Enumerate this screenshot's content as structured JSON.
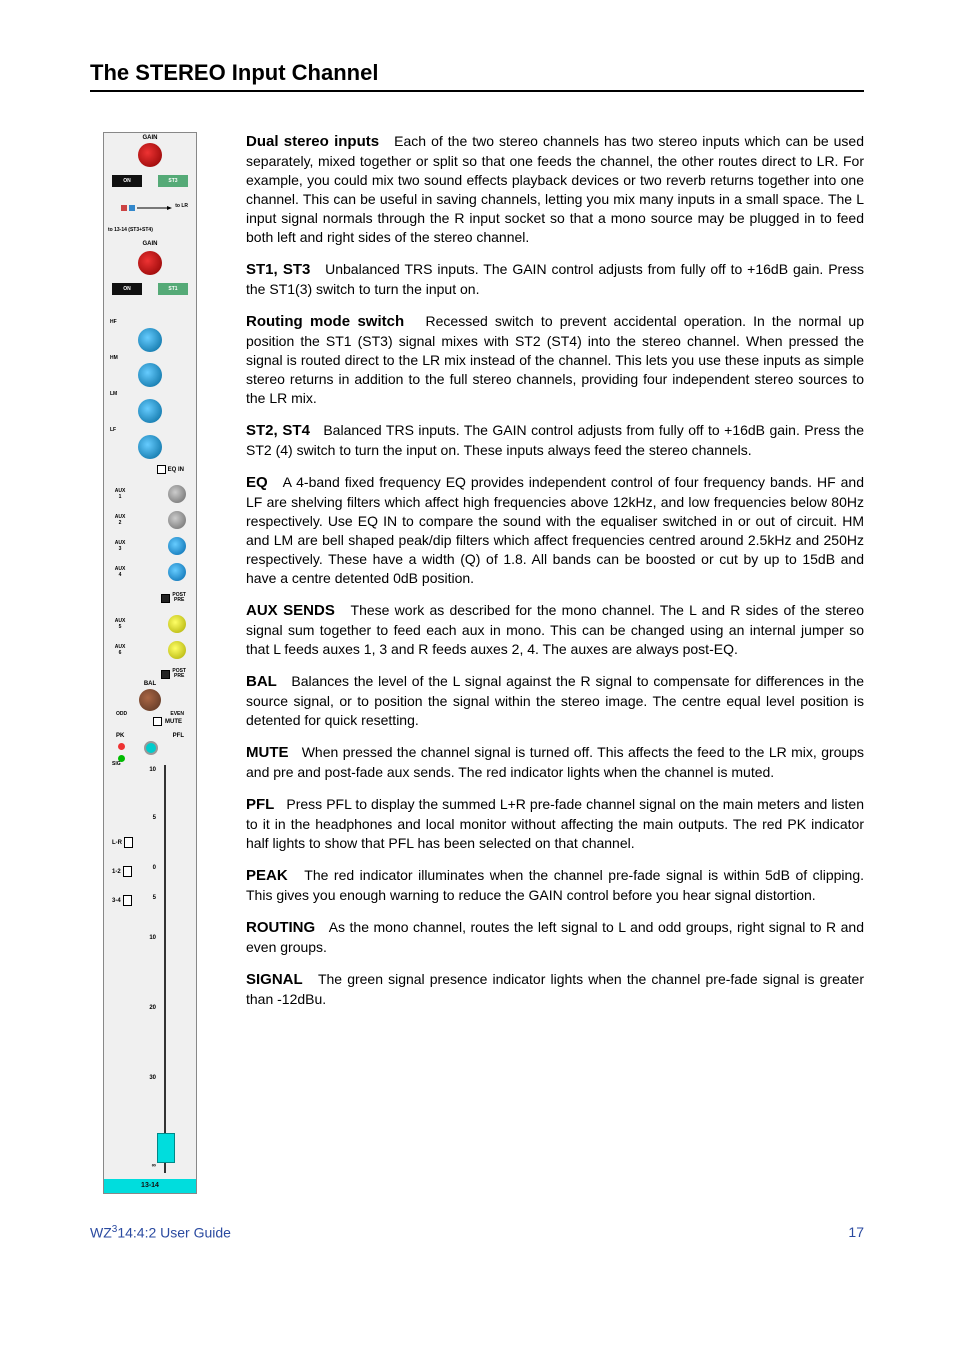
{
  "section_title": "The STEREO Input Channel",
  "panel": {
    "gain1_label": "GAIN",
    "on1": "ON",
    "st3": "ST3",
    "route_to_lr": "to LR",
    "route_to_ch": "to 13-14 (ST3+ST4)",
    "gain2_label": "GAIN",
    "on2": "ON",
    "st1": "ST1",
    "eq": {
      "hf": "HF",
      "hm": "HM",
      "lm": "LM",
      "lf": "LF",
      "eqin": "EQ IN"
    },
    "aux": {
      "a1": "AUX\n1",
      "a2": "AUX\n2",
      "a3": "AUX\n3",
      "a4": "AUX\n4",
      "a5": "AUX\n5",
      "a6": "AUX\n6",
      "post": "POST",
      "pre": "PRE"
    },
    "bal": "BAL",
    "odd": "ODD",
    "even": "EVEN",
    "mute": "MUTE",
    "pk": "PK",
    "pfl": "PFL",
    "sig": "SIG",
    "scale": {
      "p10": "10",
      "p5": "5",
      "z": "0",
      "m5": "5",
      "m10": "10",
      "m20": "20",
      "m30": "30",
      "inf": "∞"
    },
    "routes": {
      "lr": "L-R",
      "g12": "1-2",
      "g34": "3-4"
    },
    "channel": "13-14"
  },
  "paras": {
    "dual_title": "Dual stereo inputs",
    "dual": "Each of the two stereo channels has two stereo inputs which can be used separately, mixed together or split so that one feeds the channel, the other routes direct to LR.  For example, you could mix two sound effects playback devices or two reverb returns together into one channel.  This can be useful in saving channels, letting you mix many inputs in a small space.  The L input signal normals through the R input socket so that a mono source may be plugged in to feed both left and right sides of the stereo channel.",
    "st13_title": "ST1, ST3",
    "st13": "Unbalanced TRS inputs.  The GAIN control adjusts from fully off to +16dB gain.  Press the ST1(3) switch to turn the input on.",
    "route_title": "Routing mode switch",
    "route": "Recessed switch to prevent accidental operation.  In the normal up position the ST1 (ST3) signal mixes with ST2 (ST4) into the stereo channel.  When pressed the signal is routed direct to the LR mix instead of the channel.  This lets you use these inputs as simple stereo returns in addition to the full stereo channels, providing four independent stereo sources to the LR mix.",
    "st24_title": "ST2, ST4",
    "st24": "Balanced TRS inputs.  The GAIN control adjusts from fully off to +16dB gain.  Press the ST2 (4) switch to turn the input on.  These inputs always feed the stereo channels.",
    "eq_title": "EQ",
    "eq": "A 4-band fixed frequency EQ provides independent control of four frequency bands.  HF and LF are shelving filters which affect high frequencies above 12kHz, and low frequencies below 80Hz respectively.  Use EQ IN to compare the sound with the equaliser switched in or out of circuit.  HM and LM are bell shaped peak/dip filters which affect frequencies centred around 2.5kHz and 250Hz respectively.  These have a width (Q) of 1.8.  All bands can be boosted or cut by up to 15dB and have a centre detented 0dB position.",
    "aux_title": "AUX SENDS",
    "aux": "These work as described for the mono channel.  The L and R sides of the stereo signal sum together to feed each aux in mono.  This can be changed using an internal jumper so that L feeds auxes 1, 3 and R feeds auxes 2, 4.  The auxes are always post-EQ.",
    "bal_title": "BAL",
    "bal": "Balances the level of the L signal against the R signal to compensate for differences in the source signal, or to position the signal within the stereo image.  The centre equal level position is detented for quick resetting.",
    "mute_title": "MUTE",
    "mute": "When pressed the channel signal is turned off.  This affects the feed to the LR mix, groups and pre and post-fade aux sends.  The red indicator lights when the channel is muted.",
    "pfl_title": "PFL",
    "pfl": "Press PFL to display the summed L+R pre-fade channel signal on the main meters and listen to it in the headphones and local monitor without affecting the main outputs.  The red PK indicator half lights to show that PFL has been selected on that channel.",
    "peak_title": "PEAK",
    "peak": "The red indicator illuminates when the channel pre-fade signal is within 5dB of clipping.  This gives you enough warning to reduce the GAIN control before you hear signal distortion.",
    "routing_title": "ROUTING",
    "routing": "As the mono channel, routes the left signal to L and odd groups, right signal to R and even groups.",
    "signal_title": "SIGNAL",
    "signal": "The green signal presence indicator lights when the channel pre-fade signal is greater than -12dBu."
  },
  "footer": {
    "model_pre": "WZ",
    "model_sup": "3",
    "model_post": "14:4:2",
    "guide": " User Guide",
    "page": "17"
  }
}
